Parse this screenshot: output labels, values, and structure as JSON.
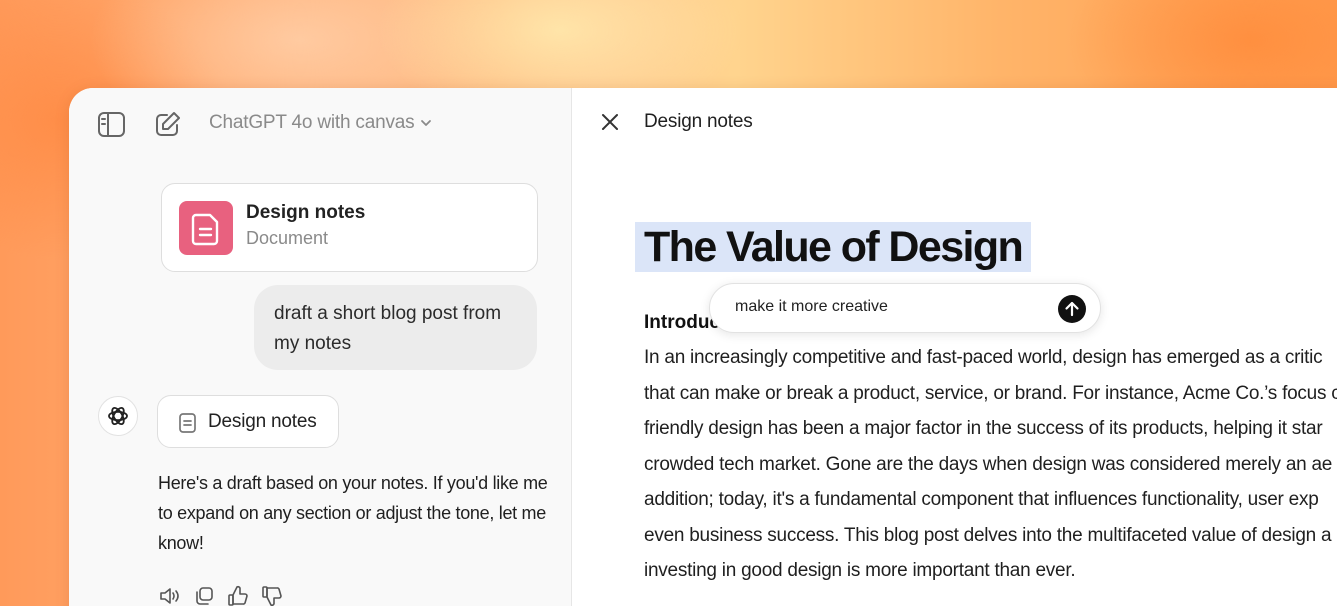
{
  "chat": {
    "model_label": "ChatGPT 4o with canvas",
    "doc_card": {
      "title": "Design notes",
      "subtitle": "Document"
    },
    "user_message": "draft a short blog post from my notes",
    "assistant": {
      "doc_ref_label": "Design notes",
      "message": "Here's a draft based on your notes. If you'd like me to expand on any section or adjust the tone, let me know!"
    }
  },
  "canvas": {
    "title": "Design notes",
    "doc": {
      "heading": "The Value of Design",
      "subheading": "Introduc",
      "body_lines": [
        "In an increasingly competitive and fast-paced world, design has emerged as a critic",
        "that can make or break a product, service, or brand. For instance, Acme Co.’s focus c",
        "friendly design has been a major factor in the success of its products, helping it star",
        "crowded tech market. Gone are the days when design was considered merely an ae",
        "addition; today, it's a fundamental component that influences functionality, user exp",
        "even business success. This blog post delves into the multifaceted value of design a",
        "investing in good design is more important than ever."
      ]
    },
    "prompt_value": "make it more creative"
  },
  "icons": {
    "sidebar_toggle": "sidebar-toggle-icon",
    "new_chat": "edit-icon",
    "model_dropdown": "chevron-down-icon",
    "doc_thumb": "document-icon",
    "assistant_avatar": "openai-logo-icon",
    "close": "close-icon",
    "send": "arrow-up-icon",
    "read_aloud": "speaker-icon",
    "copy": "copy-icon",
    "thumbs_up": "thumbs-up-icon",
    "thumbs_down": "thumbs-down-icon"
  },
  "colors": {
    "doc_accent": "#e8617f",
    "heading_highlight": "#dbe5f8"
  }
}
